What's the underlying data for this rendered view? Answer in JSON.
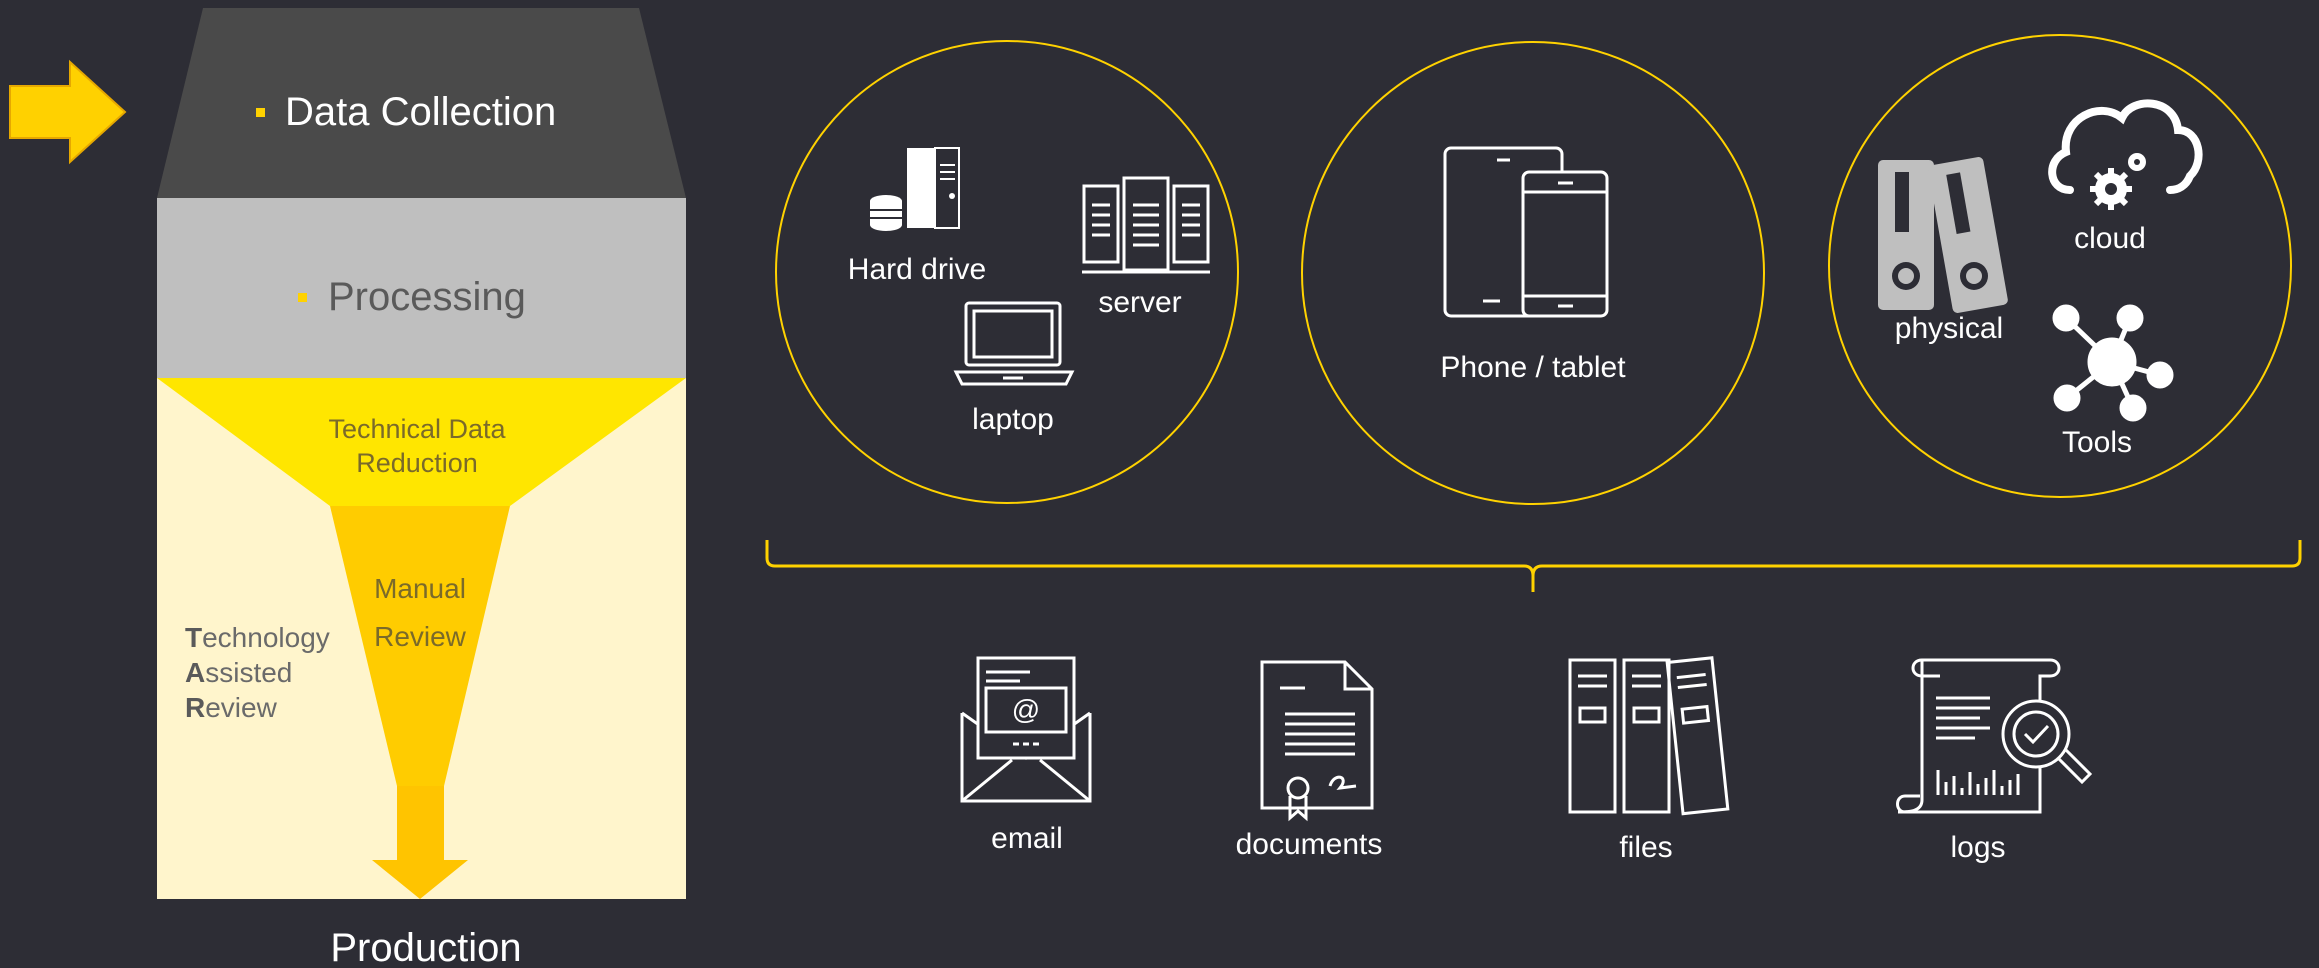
{
  "funnel": {
    "stage1": "Data Collection",
    "stage2": "Processing",
    "stage3": "Technical Data Reduction",
    "stage3_line1": "Technical Data",
    "stage3_line2": "Reduction",
    "manual_line1": "Manual",
    "manual_line2": "Review",
    "tar": [
      {
        "initial": "T",
        "rest": "echnology"
      },
      {
        "initial": "A",
        "rest": "ssisted"
      },
      {
        "initial": "R",
        "rest": "eview"
      }
    ],
    "production": "Production"
  },
  "sources": {
    "hard_drive": "Hard drive",
    "server": "server",
    "laptop": "laptop",
    "phone_tablet": "Phone / tablet",
    "physical": "physical",
    "cloud": "cloud",
    "tools": "Tools"
  },
  "data_types": {
    "email": "email",
    "documents": "documents",
    "files": "files",
    "logs": "logs"
  },
  "colors": {
    "background": "#2d2d35",
    "accent": "#ffd200",
    "stage1": "#4a4a4a",
    "stage2": "#bfbfbf",
    "tar_bg": "#fff5cc",
    "manual": "#ffcc00",
    "arrow": "#ffd100"
  },
  "icons": [
    "arrow-right-icon",
    "hard-drive-icon",
    "server-icon",
    "laptop-icon",
    "phone-tablet-icon",
    "binder-icon",
    "cloud-icon",
    "network-icon",
    "email-icon",
    "document-icon",
    "files-icon",
    "logs-icon"
  ]
}
